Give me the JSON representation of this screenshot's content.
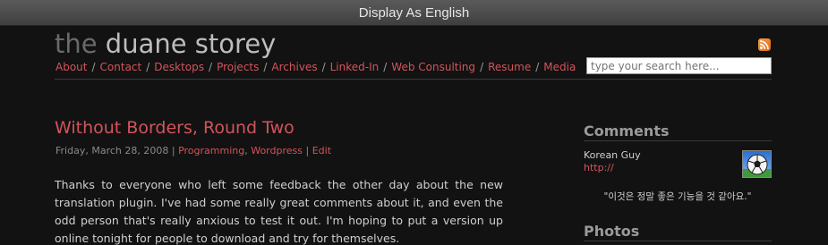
{
  "topbar": {
    "label": "Display As English"
  },
  "header": {
    "logo_the": "the",
    "logo_name": " duane storey",
    "search_placeholder": "type your search here...",
    "rss_icon": "rss-icon"
  },
  "nav": {
    "items": [
      "About",
      "Contact",
      "Desktops",
      "Projects",
      "Archives",
      "Linked-In",
      "Web Consulting",
      "Resume",
      "Media"
    ],
    "separator": "/"
  },
  "post": {
    "title": "Without Borders, Round Two",
    "date": "Friday, March 28, 2008",
    "meta_sep": "|",
    "category1": "Programming",
    "comma": ",",
    "category2": "Wordpress",
    "edit": "Edit",
    "body": "Thanks to everyone who left some feedback the other day about the new translation plugin. I've had some really great comments about it, and even the odd person that's really anxious to test it out. I'm hoping to put a version up online tonight for people to download and try for themselves."
  },
  "sidebar": {
    "comments_heading": "Comments",
    "comment_author": "Korean Guy",
    "comment_link": "http://",
    "comment_text": "\"이것은 정말 좋은 기능을 것 같아요.\"",
    "photos_heading": "Photos",
    "avatar_icon": "soccer-ball-avatar"
  },
  "colors": {
    "accent": "#d2545b",
    "background": "#121212",
    "muted": "#9a9a9a"
  }
}
